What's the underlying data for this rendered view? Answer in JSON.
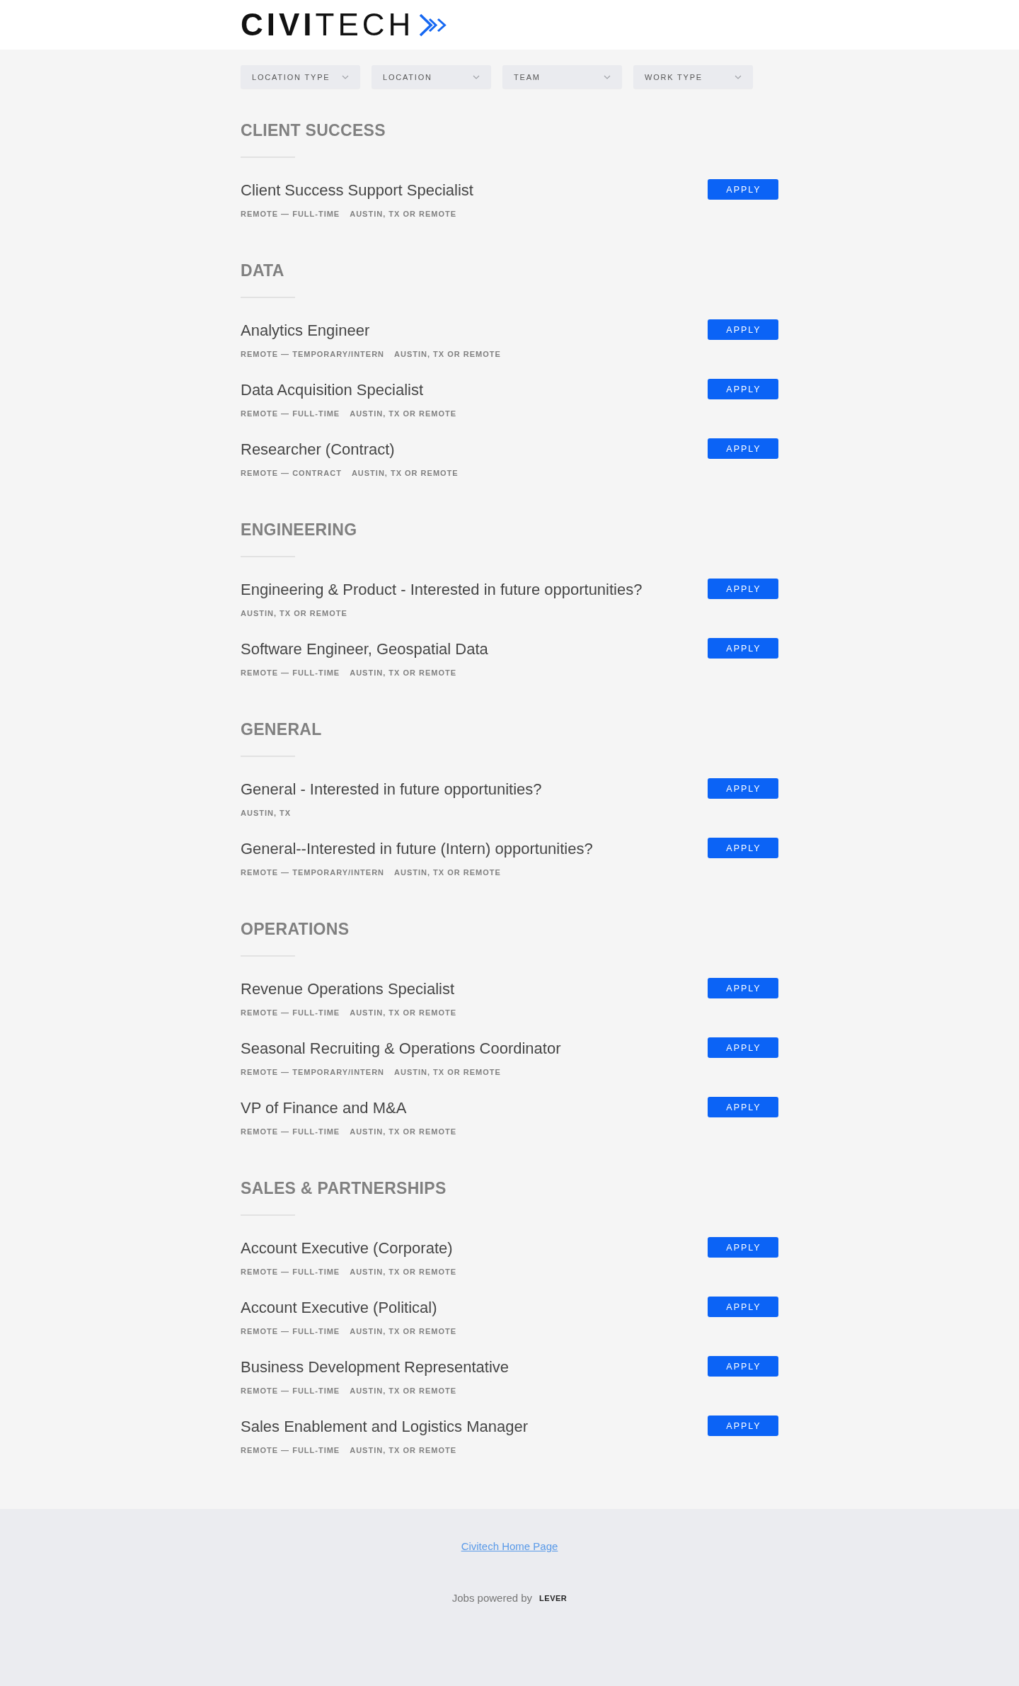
{
  "header": {
    "logo": "**CIVI**TECH"
  },
  "filters": [
    {
      "label": "LOCATION TYPE"
    },
    {
      "label": "LOCATION"
    },
    {
      "label": "TEAM"
    },
    {
      "label": "WORK TYPE"
    }
  ],
  "sections": [
    {
      "title": "CLIENT SUCCESS",
      "jobs": [
        {
          "title": "Client Success Support Specialist",
          "commitment": "REMOTE — FULL-TIME",
          "location": "AUSTIN, TX OR REMOTE",
          "button": "APPLY"
        }
      ]
    },
    {
      "title": "DATA",
      "jobs": [
        {
          "title": "Analytics Engineer",
          "commitment": "REMOTE — TEMPORARY/INTERN",
          "location": "AUSTIN, TX OR REMOTE",
          "button": "APPLY"
        },
        {
          "title": "Data Acquisition Specialist",
          "commitment": "REMOTE — FULL-TIME",
          "location": "AUSTIN, TX OR REMOTE",
          "button": "APPLY"
        },
        {
          "title": "Researcher (Contract)",
          "commitment": "REMOTE — CONTRACT",
          "location": "AUSTIN, TX OR REMOTE",
          "button": "APPLY"
        }
      ]
    },
    {
      "title": "ENGINEERING",
      "jobs": [
        {
          "title": "Engineering & Product - Interested in future opportunities?",
          "location": "AUSTIN, TX OR REMOTE",
          "button": "APPLY"
        },
        {
          "title": "Software Engineer, Geospatial Data",
          "commitment": "REMOTE — FULL-TIME",
          "location": "AUSTIN, TX OR REMOTE",
          "button": "APPLY"
        }
      ]
    },
    {
      "title": "GENERAL",
      "jobs": [
        {
          "title": "General - Interested in future opportunities?",
          "location": "AUSTIN, TX",
          "button": "APPLY"
        },
        {
          "title": "General--Interested in future (Intern) opportunities?",
          "commitment": "REMOTE — TEMPORARY/INTERN",
          "location": "AUSTIN, TX OR REMOTE",
          "button": "APPLY"
        }
      ]
    },
    {
      "title": "OPERATIONS",
      "jobs": [
        {
          "title": "Revenue Operations Specialist",
          "commitment": "REMOTE — FULL-TIME",
          "location": "AUSTIN, TX OR REMOTE",
          "button": "APPLY"
        },
        {
          "title": "Seasonal Recruiting & Operations Coordinator",
          "commitment": "REMOTE — TEMPORARY/INTERN",
          "location": "AUSTIN, TX OR REMOTE",
          "button": "APPLY"
        },
        {
          "title": "VP of Finance and M&A",
          "commitment": "REMOTE — FULL-TIME",
          "location": "AUSTIN, TX OR REMOTE",
          "button": "APPLY"
        }
      ]
    },
    {
      "title": "SALES & PARTNERSHIPS",
      "jobs": [
        {
          "title": "Account Executive (Corporate)",
          "commitment": "REMOTE — FULL-TIME",
          "location": "AUSTIN, TX OR REMOTE",
          "button": "APPLY"
        },
        {
          "title": "Account Executive (Political)",
          "commitment": "REMOTE — FULL-TIME",
          "location": "AUSTIN, TX OR REMOTE",
          "button": "APPLY"
        },
        {
          "title": "Business Development Representative",
          "commitment": "REMOTE — FULL-TIME",
          "location": "AUSTIN, TX OR REMOTE",
          "button": "APPLY"
        },
        {
          "title": "Sales Enablement and Logistics Manager",
          "commitment": "REMOTE — FULL-TIME",
          "location": "AUSTIN, TX OR REMOTE",
          "button": "APPLY"
        }
      ]
    }
  ],
  "footer": {
    "link": "Civitech Home Page",
    "powered_by": "Jobs powered by",
    "brand": "LEVER"
  }
}
